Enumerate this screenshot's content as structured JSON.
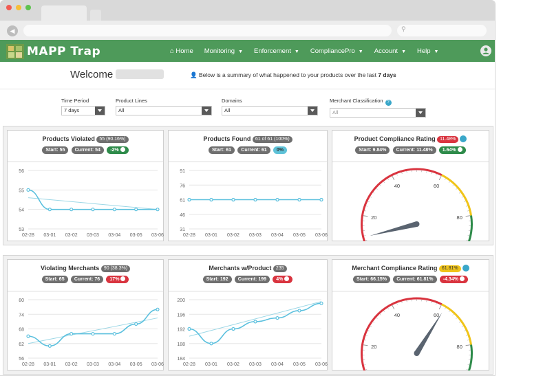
{
  "app": {
    "logo_text": "MAPP Trap",
    "colors": {
      "nav_bg": "#4e9a5a",
      "accent": "#5bc0de",
      "trend": "#9cd7e6",
      "red": "#d9343f",
      "green": "#2e8b4a",
      "yellow": "#f0c419"
    }
  },
  "nav": {
    "home": "Home",
    "items": [
      "Monitoring",
      "Enforcement",
      "CompliancePro",
      "Account",
      "Help"
    ],
    "home_icon": "home-icon",
    "user_icon": "user-icon"
  },
  "welcome": {
    "greeting": "Welcome",
    "summary_prefix": "Below is a summary of what happened to your products over the last",
    "summary_period": "7 days"
  },
  "filters": {
    "time_period": {
      "label": "Time Period",
      "value": "7 days"
    },
    "product_lines": {
      "label": "Product Lines",
      "value": "All"
    },
    "domains": {
      "label": "Domains",
      "value": "All"
    },
    "merchant_classification": {
      "label": "Merchant Classification",
      "placeholder": "All"
    }
  },
  "cards": {
    "products_violated": {
      "title": "Products Violated",
      "count": "55 (90.16%)",
      "start": "Start: 55",
      "current": "Current: 54",
      "change": "-2%"
    },
    "products_found": {
      "title": "Products Found",
      "count": "61 of 61 (100%)",
      "start": "Start: 61",
      "current": "Current: 61",
      "change": "0%"
    },
    "product_compliance": {
      "title": "Product Compliance Rating",
      "rating": "11.48%",
      "start": "Start: 9.84%",
      "current": "Current: 11.48%",
      "change": "1.64%"
    },
    "violating_merchants": {
      "title": "Violating Merchants",
      "count": "90 (38.3%)",
      "start": "Start: 65",
      "current": "Current: 76",
      "change": "17%"
    },
    "merchants_with_product": {
      "title": "Merchants w/Product",
      "count": "235",
      "start": "Start: 192",
      "current": "Current: 199",
      "change": "4%"
    },
    "merchant_compliance": {
      "title": "Merchant Compliance Rating",
      "rating": "61.81%",
      "start": "Start: 66.15%",
      "current": "Current: 61.81%",
      "change": "-4.34%"
    }
  },
  "chart_data": [
    {
      "id": "products_violated",
      "type": "line",
      "x": [
        "02-28",
        "03-01",
        "03-02",
        "03-03",
        "03-04",
        "03-05",
        "03-06"
      ],
      "values": [
        55,
        54,
        54,
        54,
        54,
        54,
        54
      ],
      "trend": [
        54.6,
        54.0
      ],
      "ylim": [
        53,
        56
      ],
      "yticks": [
        53,
        54,
        55,
        56
      ]
    },
    {
      "id": "products_found",
      "type": "line",
      "x": [
        "02-28",
        "03-01",
        "03-02",
        "03-03",
        "03-04",
        "03-05",
        "03-06"
      ],
      "values": [
        61,
        61,
        61,
        61,
        61,
        61,
        61
      ],
      "trend": [
        61,
        61
      ],
      "ylim": [
        31,
        91
      ],
      "yticks": [
        31,
        46,
        61,
        76,
        91
      ]
    },
    {
      "id": "violating_merchants",
      "type": "line",
      "x": [
        "02-28",
        "03-01",
        "03-02",
        "03-03",
        "03-04",
        "03-05",
        "03-06"
      ],
      "values": [
        65,
        61,
        66,
        66,
        66,
        70,
        76
      ],
      "trend": [
        62,
        72.5
      ],
      "ylim": [
        56,
        80
      ],
      "yticks": [
        56,
        62,
        68,
        74,
        80
      ]
    },
    {
      "id": "merchants_with_product",
      "type": "line",
      "x": [
        "02-28",
        "03-01",
        "03-02",
        "03-03",
        "03-04",
        "03-05",
        "03-06"
      ],
      "values": [
        192,
        188,
        192,
        194,
        195,
        197,
        199
      ],
      "trend": [
        190,
        199.5
      ],
      "ylim": [
        184,
        200
      ],
      "yticks": [
        184,
        188,
        192,
        196,
        200
      ]
    },
    {
      "id": "product_compliance",
      "type": "gauge",
      "value": 11.48,
      "range": [
        0,
        100
      ],
      "ticks": [
        0,
        20,
        40,
        60,
        80,
        100
      ]
    },
    {
      "id": "merchant_compliance",
      "type": "gauge",
      "value": 61.81,
      "range": [
        0,
        100
      ],
      "ticks": [
        0,
        20,
        40,
        60,
        80,
        100
      ]
    }
  ]
}
